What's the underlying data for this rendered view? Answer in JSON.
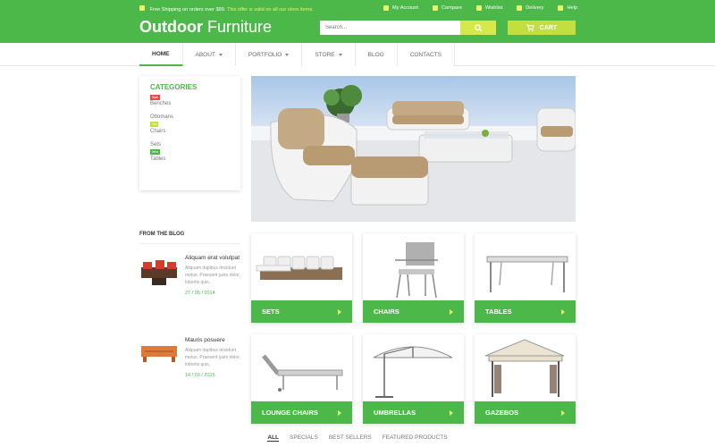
{
  "topbar": {
    "shipping_text": "Free Shipping on orders over $99.",
    "shipping_highlight": "This offer is valid on all our store items.",
    "links": [
      "My Account",
      "Compare",
      "Wishlist",
      "Delivery",
      "Help"
    ]
  },
  "brand": {
    "bold": "Outdoor",
    "rest": "Furniture"
  },
  "search": {
    "placeholder": "Search..."
  },
  "cart": {
    "label": "CART"
  },
  "nav": {
    "items": [
      {
        "label": "HOME",
        "active": true,
        "dropdown": false
      },
      {
        "label": "ABOUT",
        "active": false,
        "dropdown": true
      },
      {
        "label": "PORTFOLIO",
        "active": false,
        "dropdown": true
      },
      {
        "label": "STORE",
        "active": false,
        "dropdown": true
      },
      {
        "label": "BLOG",
        "active": false,
        "dropdown": false
      },
      {
        "label": "CONTACTS",
        "active": false,
        "dropdown": false
      }
    ]
  },
  "categories": {
    "title": "CATEGORIES",
    "items": [
      {
        "badge": "Sale",
        "badge_color": "#e84a4a",
        "label": "Benches"
      },
      {
        "badge": "",
        "label": "Ottomans"
      },
      {
        "badge": "Hot",
        "badge_color": "#c4dd3f",
        "label": "Chairs"
      },
      {
        "badge": "",
        "label": "Sets"
      },
      {
        "badge": "New",
        "badge_color": "#4cb84a",
        "label": "Tables"
      }
    ]
  },
  "blog": {
    "title": "FROM THE BLOG",
    "posts": [
      {
        "title": "Aliquam erat volutpat",
        "excerpt": "Aliquam dapibus tincidunt metus. Praesent justo dolor, lobortis quis,",
        "date": "27 / 05 / 2014"
      },
      {
        "title": "Mauris posuere",
        "excerpt": "Aliquam dapibus tincidunt metus. Praesent justo dolor, lobortis quis,",
        "date": "14 / 03 / 2015"
      }
    ]
  },
  "products": [
    {
      "label": "SETS"
    },
    {
      "label": "CHAIRS"
    },
    {
      "label": "TABLES"
    },
    {
      "label": "LOUNGE CHAIRS"
    },
    {
      "label": "UMBRELLAS"
    },
    {
      "label": "GAZEBOS"
    }
  ],
  "tabs": [
    {
      "label": "ALL",
      "active": true
    },
    {
      "label": "SPECIALS",
      "active": false
    },
    {
      "label": "BEST SELLERS",
      "active": false
    },
    {
      "label": "FEATURED PRODUCTS",
      "active": false
    }
  ],
  "colors": {
    "brand_green": "#4cb84a",
    "accent_lime": "#c4dd3f",
    "sale_red": "#e84a4a"
  }
}
